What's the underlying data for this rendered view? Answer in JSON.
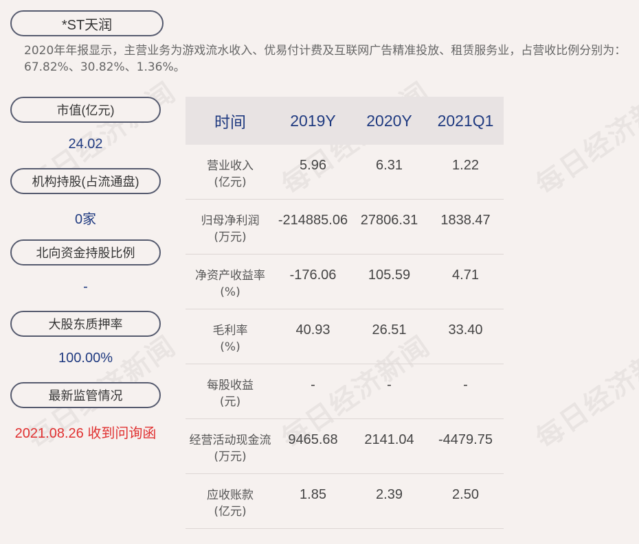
{
  "stock_name": "*ST天润",
  "summary": "2020年年报显示，主营业务为游戏流水收入、优易付计费及互联网广告精准投放、租赁服务业，占营收比例分别为：67.82%、30.82%、1.36%。",
  "sidebar": [
    {
      "label": "市值(亿元)",
      "value": "24.02"
    },
    {
      "label": "机构持股(占流通盘)",
      "value": "0家"
    },
    {
      "label": "北向资金持股比例",
      "value": "-"
    },
    {
      "label": "大股东质押率",
      "value": "100.00%"
    },
    {
      "label": "最新监管情况",
      "value": "2021.08.26 收到问询函"
    }
  ],
  "table": {
    "headers": [
      "时间",
      "2019Y",
      "2020Y",
      "2021Q1"
    ],
    "rows": [
      {
        "label": "营业收入",
        "unit": "(亿元)",
        "values": [
          "5.96",
          "6.31",
          "1.22"
        ]
      },
      {
        "label": "归母净利润",
        "unit": "(万元)",
        "values": [
          "-214885.06",
          "27806.31",
          "1838.47"
        ]
      },
      {
        "label": "净资产收益率",
        "unit": "(%)",
        "values": [
          "-176.06",
          "105.59",
          "4.71"
        ]
      },
      {
        "label": "毛利率",
        "unit": "(%)",
        "values": [
          "40.93",
          "26.51",
          "33.40"
        ]
      },
      {
        "label": "每股收益",
        "unit": "(元)",
        "values": [
          "-",
          "-",
          "-"
        ]
      },
      {
        "label": "经营活动现金流",
        "unit": "(万元)",
        "values": [
          "9465.68",
          "2141.04",
          "-4479.75"
        ]
      },
      {
        "label": "应收账款",
        "unit": "(亿元)",
        "values": [
          "1.85",
          "2.39",
          "2.50"
        ]
      }
    ]
  },
  "watermark": "每日经济新闻",
  "colors": {
    "background": "#f6f1ef",
    "accent": "#1f3a80",
    "alert": "#e03030"
  }
}
